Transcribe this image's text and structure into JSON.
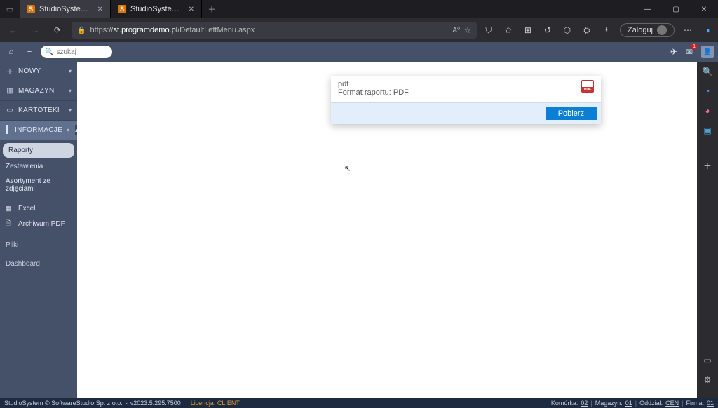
{
  "browser": {
    "tabs": [
      {
        "title": "StudioSystem.NET (c) SoftwareS…",
        "active": true
      },
      {
        "title": "StudioSystem.NET (c) SoftwareS…",
        "active": false
      }
    ],
    "url_prefix": "https://",
    "url_host": "st.programdemo.pl",
    "url_path": "/DefaultLeftMenu.aspx",
    "login_label": "Zaloguj"
  },
  "appbar": {
    "search_placeholder": "szukaj"
  },
  "sidebar": {
    "sections": [
      {
        "icon": "＋",
        "label": "NOWY"
      },
      {
        "icon": "▥",
        "label": "MAGAZYN"
      },
      {
        "icon": "▭",
        "label": "KARTOTEKI"
      },
      {
        "icon": "▌",
        "label": "INFORMACJE"
      }
    ],
    "sub_items": [
      "Raporty",
      "Zestawienia",
      "Asortyment ze zdjęciami"
    ],
    "tool_links": [
      {
        "icon": "▦",
        "label": "Excel"
      },
      {
        "icon": "🗎",
        "label": "Archiwum PDF"
      }
    ],
    "headings": [
      "Pliki",
      "Dashboard"
    ]
  },
  "dialog": {
    "title": "pdf",
    "subtitle": "Format raportu: PDF",
    "button": "Pobierz",
    "pdf_badge": "PDF"
  },
  "status": {
    "copyright": "StudioSystem © SoftwareStudio Sp. z o.o.",
    "version": "v2023.5.295.7500",
    "license": "Licencja: CLIENT",
    "cell_label": "Komórka:",
    "cell_value": "02",
    "mag_label": "Magazyn:",
    "mag_value": "01",
    "dept_label": "Oddział:",
    "dept_value": "CEN",
    "firm_label": "Firma:",
    "firm_value": "01"
  }
}
